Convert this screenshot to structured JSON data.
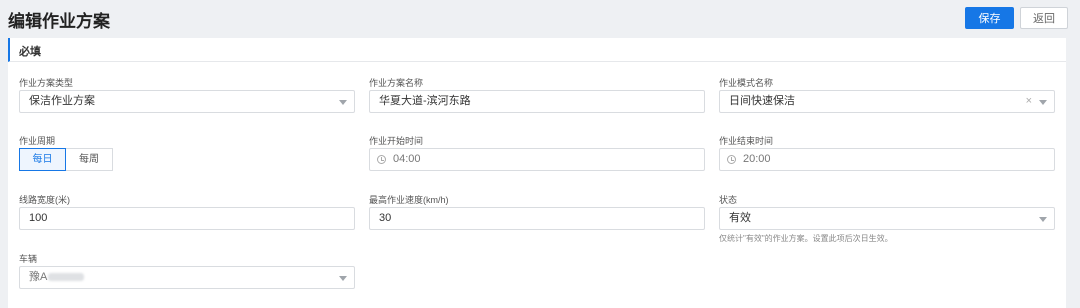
{
  "header": {
    "title": "编辑作业方案",
    "save_label": "保存",
    "back_label": "返回"
  },
  "section": {
    "title": "必填"
  },
  "fields": {
    "scheme_type": {
      "label": "作业方案类型",
      "value": "保洁作业方案"
    },
    "scheme_name": {
      "label": "作业方案名称",
      "value": "华夏大道-滨河东路"
    },
    "mode_name": {
      "label": "作业模式名称",
      "value": "日间快速保洁",
      "clear_icon": "×"
    },
    "cycle": {
      "label": "作业周期",
      "options": [
        "每日",
        "每周"
      ],
      "selected": "每日"
    },
    "start_time": {
      "label": "作业开始时间",
      "value": "04:00"
    },
    "end_time": {
      "label": "作业结束时间",
      "value": "20:00"
    },
    "road_width": {
      "label": "线路宽度(米)",
      "value": "100"
    },
    "max_speed": {
      "label": "最高作业速度(km/h)",
      "value": "30"
    },
    "status": {
      "label": "状态",
      "value": "有效",
      "hint": "仅统计\"有效\"的作业方案。设置此项后次日生效。"
    },
    "vehicle": {
      "label": "车辆",
      "value": "豫A"
    }
  },
  "colors": {
    "accent": "#1677e6"
  },
  "icons": [
    "caret-down-icon",
    "clock-icon",
    "clear-icon"
  ]
}
